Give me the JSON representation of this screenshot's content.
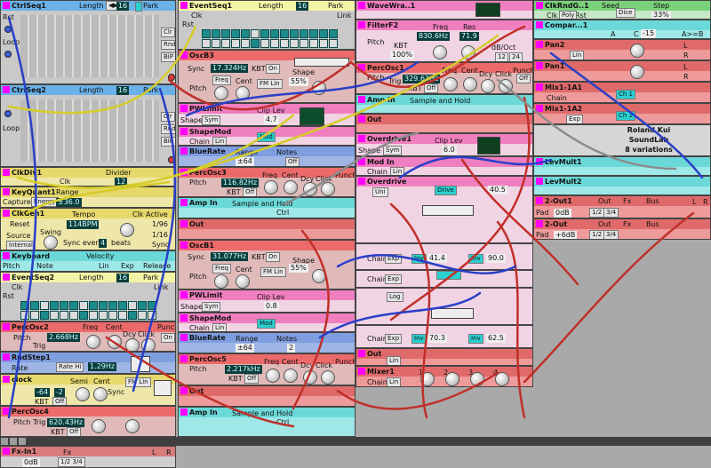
{
  "modules": {
    "ctrlseq1": {
      "title": "CtrlSeq1",
      "length_label": "Length",
      "length": "16",
      "park": "Park",
      "rst": "Rst",
      "clr": "Clr",
      "rnd": "Rnd",
      "bip": "BiP",
      "loop": "Loop"
    },
    "ctrlseq2": {
      "title": "CtrlSeq2",
      "length_label": "Length",
      "length": "16",
      "park": "Park",
      "clr": "Clr",
      "rnd": "Rnd",
      "bip": "BiP",
      "loop": "Loop"
    },
    "clkdiv1": {
      "title": "ClkDiv1",
      "divider": "Divider",
      "value": "12",
      "clk": "Clk",
      "rst": "Rst"
    },
    "keyquant1": {
      "title": "KeyQuant1",
      "range": "Range",
      "capture": "Capture",
      "energy": "Energy",
      "value": "±36.0"
    },
    "clkgen1": {
      "title": "ClkGen1",
      "reset": "Reset",
      "tempo": "Tempo",
      "bpm": "114BPM",
      "clk_active": "Clk Active",
      "source": "Source",
      "internal": "Internal",
      "swing": "Swing",
      "sync_every": "Sync every",
      "sync_val": "4",
      "beats": "beats",
      "d1": "1/96",
      "d2": "1/16",
      "d3": "Sync"
    },
    "keyboard": {
      "title": "Keyboard",
      "velocity": "Velocity",
      "pitch": "Pitch",
      "note": "Note",
      "lin": "Lin",
      "exp": "Exp",
      "release": "Release"
    },
    "eventseq2": {
      "title": "EventSeq2",
      "length_label": "Length",
      "length": "16",
      "park": "Park",
      "link": "Link",
      "clk": "Clk",
      "rst": "Rst"
    },
    "percosc2": {
      "title": "PercOsc2",
      "pitch": "Pitch",
      "freq": "Freq",
      "cent": "Cent",
      "dcy": "Dcy",
      "click": "Click",
      "punch": "Punch",
      "trig": "Trig",
      "value": "2.668Hz",
      "on": "On",
      "kbt": "KBT"
    },
    "rndstep1": {
      "title": "RndStep1",
      "rate": "Rate",
      "rate_hi": "Rate Hi",
      "value": "1.29Hz"
    },
    "clock": {
      "title": "clock",
      "semi": "Semi",
      "cent": "Cent",
      "fm_lin": "FM Lin",
      "sync": "Sync",
      "v1": "-64",
      "v2": "-2",
      "kbt": "KBT",
      "off": "Off"
    },
    "percosc4": {
      "title": "PercOsc4",
      "pitch": "Pitch",
      "trig": "Trig",
      "value": "620.43Hz",
      "kbt": "KBT",
      "off": "Off",
      "dcy": "Dcy",
      "click": "Click",
      "punch": "Punch"
    },
    "fxin1": {
      "title": "Fx-In1",
      "fx": "Fx",
      "db": "0dB",
      "ratio": "1/2 3/4",
      "l": "L",
      "r": "R"
    },
    "eventseq1": {
      "title": "EventSeq1",
      "length_label": "Length",
      "length": "16",
      "park": "Park",
      "link": "Link",
      "clk": "Clk",
      "rst": "Rst"
    },
    "oscb3": {
      "title": "OscB3",
      "sync": "Sync",
      "value": "17.324Hz",
      "kbt": "KBT",
      "on": "On",
      "shape": "Shape",
      "shape_val": "55%",
      "pitch": "Pitch",
      "freq": "Freq",
      "cent": "Cent",
      "fm_lin": "FM Lin"
    },
    "pwlimit": {
      "title": "PWLimit",
      "shape": "Shape",
      "sym": "Sym",
      "clip_lev": "Clip Lev",
      "value": "4.7"
    },
    "shapemod": {
      "title": "ShapeMod",
      "chain": "Chain",
      "lin": "Lin",
      "mod": "Mod"
    },
    "bluerate": {
      "title": "BlueRate",
      "range": "Range",
      "notes": "Notes",
      "range_val": "±64",
      "notes_val": "1",
      "off": "Off"
    },
    "percosc3": {
      "title": "PercOsc3",
      "pitch": "Pitch",
      "value": "116.82Hz",
      "kbt": "KBT",
      "off": "Off",
      "freq": "Freq",
      "cent": "Cent",
      "dcy": "Dcy",
      "click": "Click",
      "punch": "Punch"
    },
    "ampin1": {
      "title": "Amp In",
      "sah": "Sample and Hold",
      "ctrl": "Ctrl"
    },
    "out1": {
      "title": "Out"
    },
    "oscb1": {
      "title": "OscB1",
      "sync": "Sync",
      "value": "31.077Hz",
      "kbt": "KBT",
      "on": "On",
      "shape": "Shape",
      "shape_val": "55%",
      "pitch": "Pitch",
      "freq": "Freq",
      "cent": "Cent",
      "fm_lin": "FM Lin"
    },
    "pwlimit2": {
      "title": "PWLimit",
      "shape": "Shape",
      "sym": "Sym",
      "clip_lev": "Clip Lev",
      "value": "0.8"
    },
    "shapemod2": {
      "title": "ShapeMod",
      "chain": "Chain",
      "lin": "Lin",
      "mod": "Mod"
    },
    "bluerate2": {
      "title": "BlueRate",
      "range": "Range",
      "notes": "Notes",
      "range_val": "±64",
      "notes_val": "2"
    },
    "percosc5": {
      "title": "PercOsc5",
      "pitch": "Pitch",
      "value": "2.217kHz",
      "kbt": "KBT",
      "off": "Off",
      "freq": "Freq",
      "cent": "Cent",
      "dcy": "Dcy",
      "click": "Click",
      "punch": "Punch"
    },
    "out2": {
      "title": "Out"
    },
    "ampin2": {
      "title": "Amp In",
      "sah": "Sample and Hold",
      "ctrl": "Ctrl"
    },
    "wavewra": {
      "title": "WaveWra..1"
    },
    "filterf2": {
      "title": "FilterF2",
      "pitch": "Pitch",
      "freq": "Freq",
      "res": "Res",
      "freq_val": "830.6Hz",
      "res_val": "71.9",
      "kbt": "KBT",
      "kbt_val": "100%",
      "db_oct": "dB/Oct",
      "o1": "12",
      "o2": "24"
    },
    "percosc1": {
      "title": "PercOsc1",
      "pitch": "Pitch",
      "trig": "Trig",
      "value": "329.63Hz",
      "kbt": "KBT",
      "off": "Off",
      "freq": "Freq",
      "cent": "Cent",
      "dcy": "Dcy",
      "click": "Click",
      "punch": "Punch",
      "punch_off": "Off"
    },
    "ampin3": {
      "title": "Amp In",
      "sah": "Sample and Hold"
    },
    "out3": {
      "title": "Out"
    },
    "overdrive1": {
      "title": "Overdrive1",
      "shape": "Shape",
      "sym": "Sym",
      "clip_lev": "Clip Lev",
      "value": "6.0"
    },
    "modin": {
      "title": "Mod In",
      "chain": "Chain",
      "lin": "Lin"
    },
    "overdrive": {
      "title": "Overdrive",
      "uni": "Uni",
      "drive": "Drive",
      "value": "40.5"
    },
    "chain1": {
      "chain": "Chain",
      "exp": "Exp",
      "inv": "Inv",
      "v1": "41.4",
      "v2": "90.0"
    },
    "chain2": {
      "chain": "Chain",
      "exp": "Exp"
    },
    "log": {
      "label": "Log"
    },
    "chain3": {
      "chain": "Chain",
      "exp": "Exp",
      "inv": "Inv",
      "v1": "70.3",
      "v2": "62.5"
    },
    "out4": {
      "title": "Out",
      "lin": "Lin"
    },
    "mixer1": {
      "title": "Mixer1",
      "chain": "Chain",
      "lin": "Lin",
      "n1": "1",
      "n2": "2",
      "n3": "3",
      "n4": "4"
    },
    "clkrndg": {
      "title": "ClkRndG..1",
      "seed": "Seed",
      "step": "Step",
      "clk": "Clk",
      "rst": "Rst",
      "poly": "Poly",
      "dice": "Dice",
      "pct": "33%"
    },
    "compar": {
      "title": "Compar...1",
      "a": "A",
      "c": "C",
      "val": "-15",
      "agtb": "A>=B"
    },
    "pan2": {
      "title": "Pan2",
      "lin": "Lin",
      "l": "L",
      "r": "R"
    },
    "pan1": {
      "title": "Pan1",
      "l": "L",
      "r": "R"
    },
    "mix1a1": {
      "title": "Mix1-1A1",
      "ch": "Ch 1",
      "chain": "Chain"
    },
    "mix1a2": {
      "title": "Mix1-1A2",
      "ch": "Ch 1",
      "exp": "Exp"
    },
    "info": {
      "line1": "Roland Kui",
      "line2": "SoundLab",
      "line3": "8 variations"
    },
    "levmult1": {
      "title": "LevMult1"
    },
    "levmult2": {
      "title": "LevMult2"
    },
    "out2_1": {
      "title": "2-Out1",
      "out": "Out",
      "fx": "Fx",
      "bus": "Bus",
      "pad": "Pad",
      "db": "0dB",
      "r1": "1/2",
      "r2": "3/4",
      "l": "L",
      "r": "R"
    },
    "out2_2": {
      "title": "2-Out",
      "out": "Out",
      "fx": "Fx",
      "bus": "Bus",
      "pad": "Pad",
      "db": "+6dB",
      "r1": "1/2",
      "r2": "3/4"
    }
  },
  "colors": {
    "wire_red": "#c0302a",
    "wire_blue": "#2a3fc8",
    "wire_yellow": "#d6cc2a",
    "wire_grey": "#8b8b8b"
  }
}
